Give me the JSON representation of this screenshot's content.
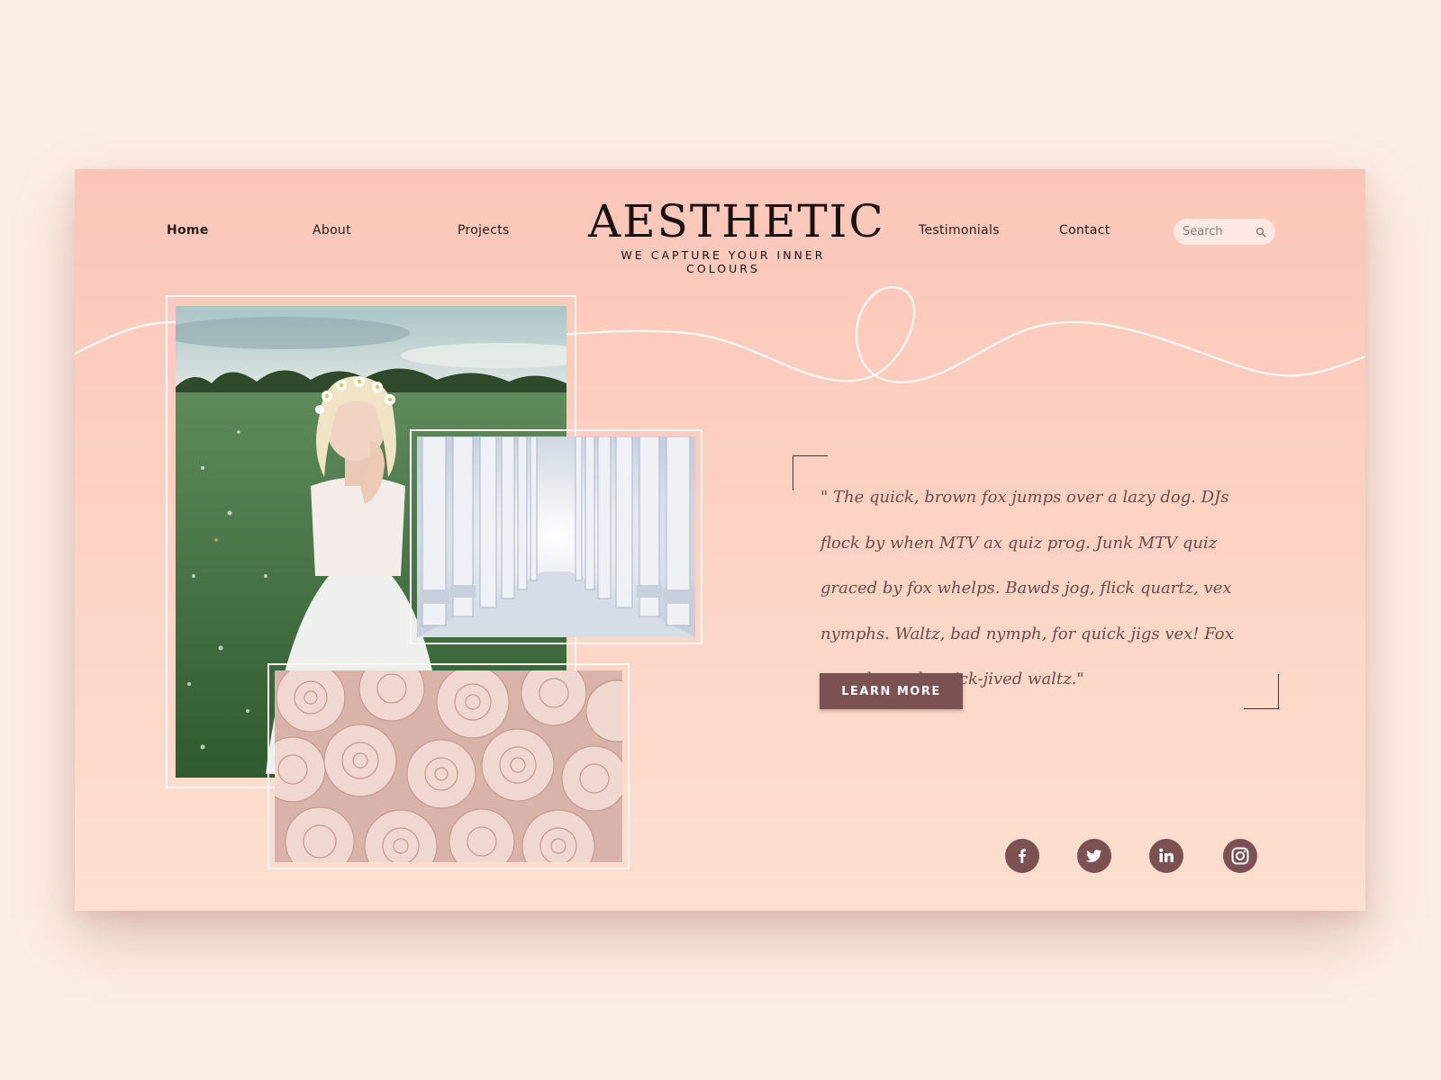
{
  "nav": {
    "left": [
      {
        "label": "Home",
        "active": true
      },
      {
        "label": "About"
      },
      {
        "label": "Projects"
      }
    ],
    "right": [
      {
        "label": "Testimonials"
      },
      {
        "label": "Contact"
      }
    ]
  },
  "logo": {
    "title": "AESTHETIC",
    "tagline": "WE CAPTURE YOUR INNER COLOURS"
  },
  "search": {
    "placeholder": "Search",
    "icon": "search-icon"
  },
  "quote": {
    "text": "\" The quick, brown fox jumps over a lazy dog. DJs flock by when MTV ax quiz prog. Junk MTV quiz graced by fox whelps. Bawds jog, flick quartz, vex nymphs. Waltz, bad nymph, for quick jigs vex! Fox nymphs grab quick-jived waltz.\""
  },
  "cta": {
    "label": "LEARN MORE"
  },
  "social": [
    {
      "name": "facebook-icon"
    },
    {
      "name": "twitter-icon"
    },
    {
      "name": "linkedin-icon"
    },
    {
      "name": "instagram-icon"
    }
  ],
  "colors": {
    "background": "#fdeee3",
    "card_top": "#fbc6b9",
    "card_bottom": "#fde0d0",
    "accent": "#7b5152",
    "text_dark": "#1a1111"
  }
}
